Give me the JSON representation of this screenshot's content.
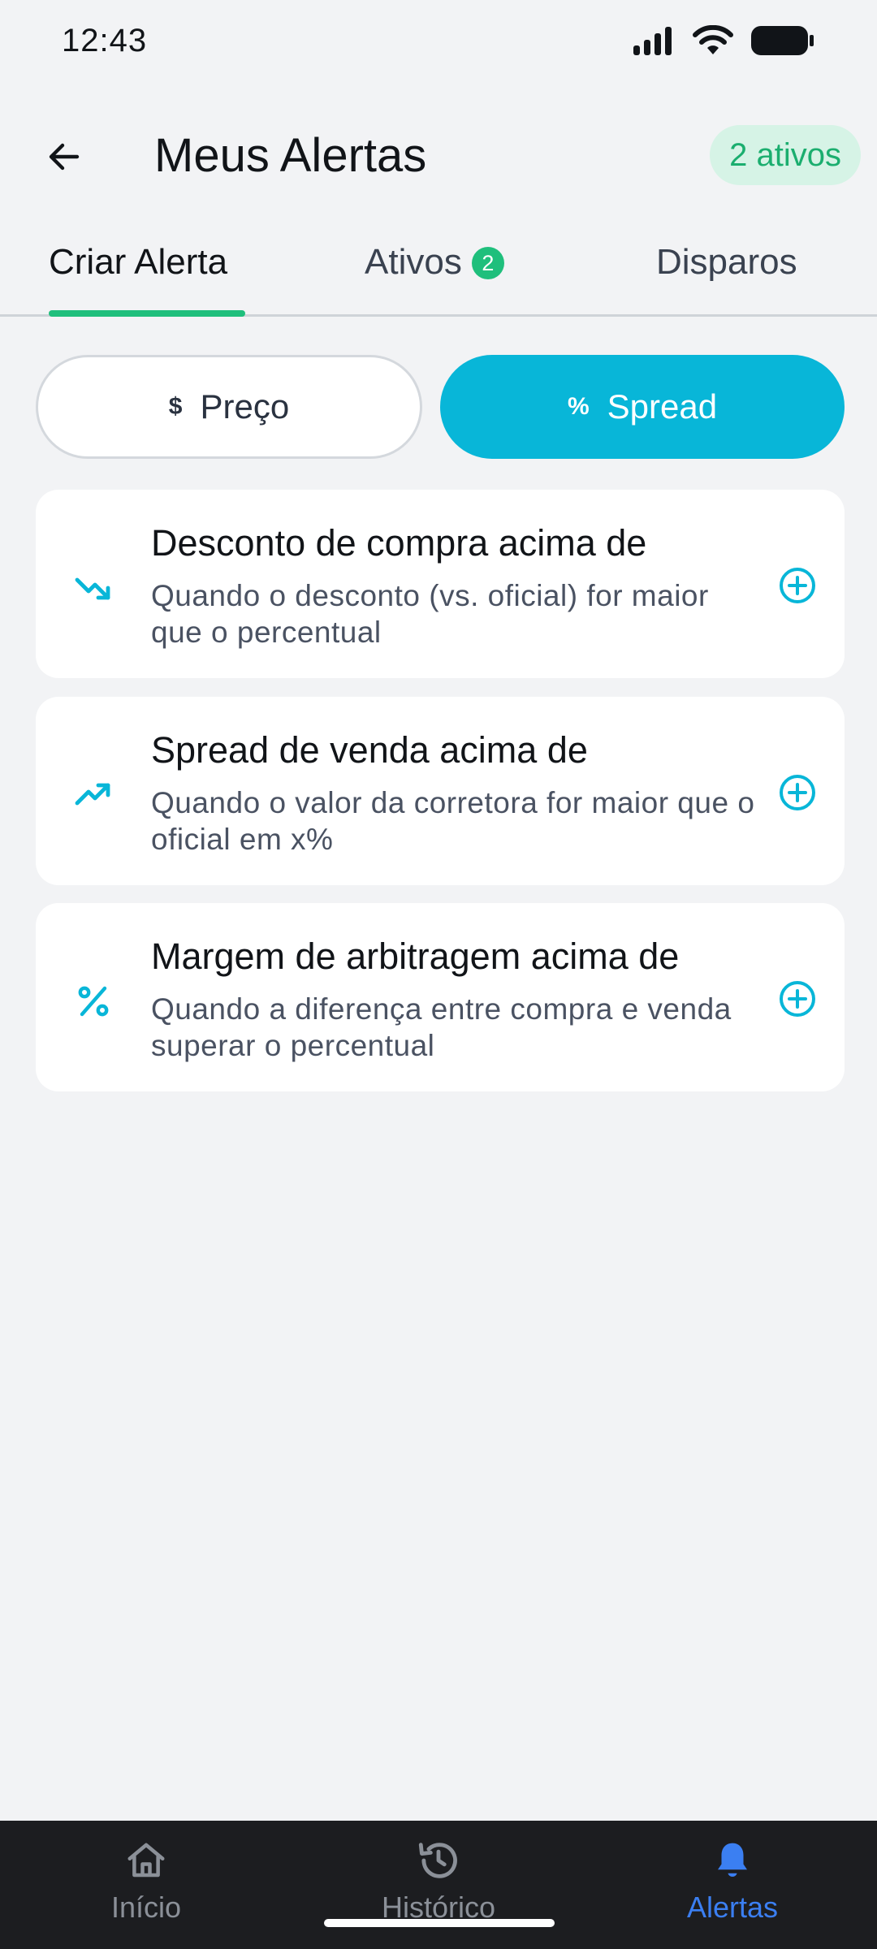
{
  "status_bar": {
    "time": "12:43"
  },
  "header": {
    "title": "Meus Alertas",
    "active_badge": "2 ativos"
  },
  "tabs": [
    {
      "label": "Criar Alerta",
      "active": true
    },
    {
      "label": "Ativos",
      "count": "2",
      "active": false
    },
    {
      "label": "Disparos",
      "active": false
    }
  ],
  "toggle": {
    "preco": {
      "glyph": "$",
      "label": "Preço",
      "selected": false
    },
    "spread": {
      "glyph": "%",
      "label": "Spread",
      "selected": true
    }
  },
  "alert_types": [
    {
      "icon": "trending-down-icon",
      "title": "Desconto de compra acima de",
      "description": "Quando o desconto (vs. oficial) for maior que o percentual"
    },
    {
      "icon": "trending-up-icon",
      "title": "Spread de venda acima de",
      "description": "Quando o valor da corretora for maior que o oficial em x%"
    },
    {
      "icon": "percent-icon",
      "title": "Margem de arbitragem acima de",
      "description": "Quando a diferença entre compra e venda superar o percentual"
    }
  ],
  "bottom_nav": [
    {
      "label": "Início",
      "icon": "home-icon",
      "active": false
    },
    {
      "label": "Histórico",
      "icon": "history-icon",
      "active": false
    },
    {
      "label": "Alertas",
      "icon": "bell-icon",
      "active": true
    }
  ],
  "colors": {
    "accent_cyan": "#08b6d8",
    "accent_green": "#1fbf7c",
    "nav_active": "#3b7ff2"
  }
}
